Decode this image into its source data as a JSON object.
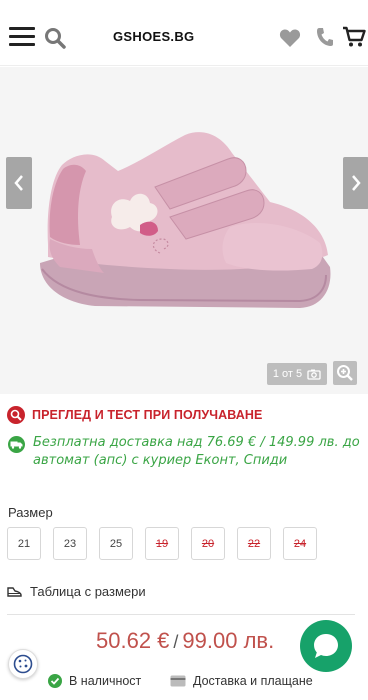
{
  "header": {
    "logo": "GSHOES.BG",
    "icons": [
      "menu-icon",
      "search-icon",
      "heart-icon",
      "phone-icon",
      "cart-icon"
    ]
  },
  "gallery": {
    "counter": "1 от 5",
    "icons": [
      "chevron-left-icon",
      "chevron-right-icon",
      "camera-icon",
      "zoom-in-icon"
    ]
  },
  "promos": {
    "inspection": "ПРЕГЛЕД И ТЕСТ ПРИ ПОЛУЧАВАНЕ",
    "free_delivery": "Безплатна доставка над 76.69 € / 149.99 лв. до автомат (апс) с куриер Еконт, Спиди"
  },
  "sizes": {
    "title": "Размер",
    "available": [
      "21",
      "23",
      "25"
    ],
    "unavailable": [
      "19",
      "20",
      "22",
      "24"
    ]
  },
  "size_chart": {
    "label": "Таблица с размери"
  },
  "price": {
    "eur": "50.62 €",
    "separator": "/",
    "bgn": "99.00 лв."
  },
  "bottom": {
    "in_stock": "В наличност",
    "delivery": "Доставка и плащане"
  },
  "colors": {
    "accent_red": "#c8232c",
    "green": "#3aa545",
    "chat_green": "#17a26a",
    "price_red": "#c0514c"
  }
}
